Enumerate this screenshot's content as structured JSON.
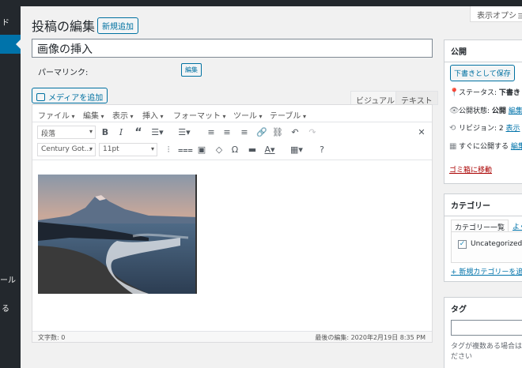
{
  "sidebar": {
    "items": [
      {
        "label": "ド"
      },
      {
        "label": "ール"
      },
      {
        "label": "る"
      }
    ]
  },
  "screen_options": "表示オプション",
  "page": {
    "title": "投稿の編集",
    "add_new": "新規追加"
  },
  "post": {
    "title": "画像の挿入",
    "permalink_label": "パーマリンク:",
    "edit_slug": "編集"
  },
  "media": {
    "add_media": "メディアを追加"
  },
  "editor": {
    "tabs": [
      "ビジュアル",
      "テキスト"
    ],
    "menus": [
      "ファイル",
      "編集",
      "表示",
      "挿入",
      "フォーマット",
      "ツール",
      "テーブル"
    ],
    "format_select": "段落",
    "font_select": "Century Got...",
    "size_select": "11pt",
    "word_count": "文字数: 0",
    "last_edit": "最後の編集: 2020年2月19日 8:35 PM"
  },
  "publish": {
    "title": "公開",
    "save_draft": "下書きとして保存",
    "status_label": "ステータス:",
    "status_value": "下書き",
    "visibility_label": "公開状態:",
    "visibility_value": "公開",
    "visibility_edit": "編集",
    "revisions_label": "リビジョン: 2",
    "revisions_link": "表示",
    "schedule_label": "すぐに公開する",
    "schedule_edit": "編集",
    "trash": "ゴミ箱に移動"
  },
  "category": {
    "title": "カテゴリー",
    "tab_all": "カテゴリー一覧",
    "tab_popular": "よく使うもの",
    "item": "Uncategorized",
    "add_new": "+ 新規カテゴリーを追加"
  },
  "tags": {
    "title": "タグ",
    "hint_line1": "タグが複数ある場合はコンマで区切ってく",
    "hint_line2": "ださい"
  }
}
